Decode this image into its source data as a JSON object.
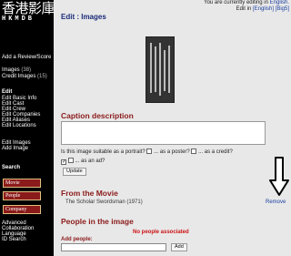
{
  "logo": {
    "cjk": "香港影庫",
    "latin": "HKMDB"
  },
  "sidebar": {
    "review": "Add a Review/Score",
    "images_label": "Images",
    "images_count": "(38)",
    "credit_label": "Credit Images",
    "credit_count": "(15)",
    "edit_head": "Edit",
    "edit_items": [
      "Edit Basic Info",
      "Edit Cast",
      "Edit Crew",
      "Edit Companies",
      "Edit Aliases",
      "Edit Locations"
    ],
    "edit_images": "Edit Images",
    "add_image": "Add Image",
    "search_head": "Search",
    "search_buttons": [
      "Movie",
      "People",
      "Company"
    ],
    "bottom_links": [
      "Advanced",
      "Collaboration",
      "Language",
      "ID Search"
    ]
  },
  "top": {
    "line1_prefix": "You are currently editing in",
    "line1_lang": "English.",
    "line2_prefix": "Edit in",
    "line2_en": "[English]",
    "line2_big5": "[Big5]"
  },
  "title": "Edit : Images",
  "caption": {
    "heading": "Caption description",
    "value": ""
  },
  "suitability": {
    "question": "Is this image suitable as a portrait?",
    "poster": "... as a poster?",
    "credit": "... as a credit?",
    "ad": "... as an ad?",
    "portrait_checked": false,
    "poster_checked": false,
    "credit_checked": true,
    "ad_checked": false
  },
  "update_button": "Update",
  "movie": {
    "heading": "From the Movie",
    "title": "The Scholar Swordsman (1971)",
    "remove": "Remove"
  },
  "people": {
    "heading": "People in the image",
    "none": "No people associated",
    "add_label": "Add people:",
    "add_value": "",
    "add_button": "Add"
  },
  "colors": {
    "sidebar_bg": "#000000",
    "heading_red": "#8b1a1a",
    "link_blue": "#1a3fa0",
    "button_red": "#8b1a1a"
  }
}
